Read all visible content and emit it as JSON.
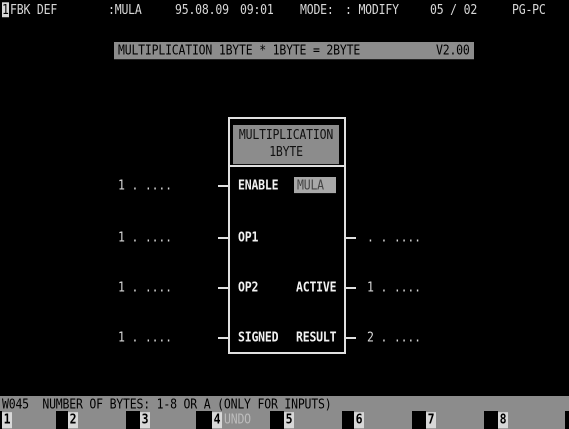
{
  "status": {
    "fkey_indicator": "1",
    "block": "FBK DEF",
    "module": ":MULA",
    "date": "95.08.09",
    "time": "09:01",
    "mode_label": "MODE:",
    "mode_value": ": MODIFY",
    "page": "05 / 02",
    "device": "PG-PC"
  },
  "banner": {
    "title": "MULTIPLICATION 1BYTE * 1BYTE = 2BYTE",
    "version": "V2.00"
  },
  "block": {
    "header_line1": "MULTIPLICATION",
    "header_line2": "1BYTE",
    "instance_name": "MULA",
    "inputs": [
      {
        "value": "1 . ....",
        "pin": "ENABLE"
      },
      {
        "value": "1 . ....",
        "pin": "OP1"
      },
      {
        "value": "1 . ....",
        "pin": "OP2"
      },
      {
        "value": "1 . ....",
        "pin": "SIGNED"
      }
    ],
    "outputs": [
      {
        "pin": "",
        "value": ". . ...."
      },
      {
        "pin": "ACTIVE",
        "value": "1 . ...."
      },
      {
        "pin": "RESULT",
        "value": "2 . ...."
      }
    ]
  },
  "message": "W045  NUMBER OF BYTES: 1-8 OR A (ONLY FOR INPUTS)",
  "fkeys": [
    {
      "num": "1",
      "label": ""
    },
    {
      "num": "2",
      "label": ""
    },
    {
      "num": "3",
      "label": ""
    },
    {
      "num": "4",
      "label": "UNDO"
    },
    {
      "num": "5",
      "label": ""
    },
    {
      "num": "6",
      "label": ""
    },
    {
      "num": "7",
      "label": ""
    },
    {
      "num": "8",
      "label": ""
    }
  ]
}
